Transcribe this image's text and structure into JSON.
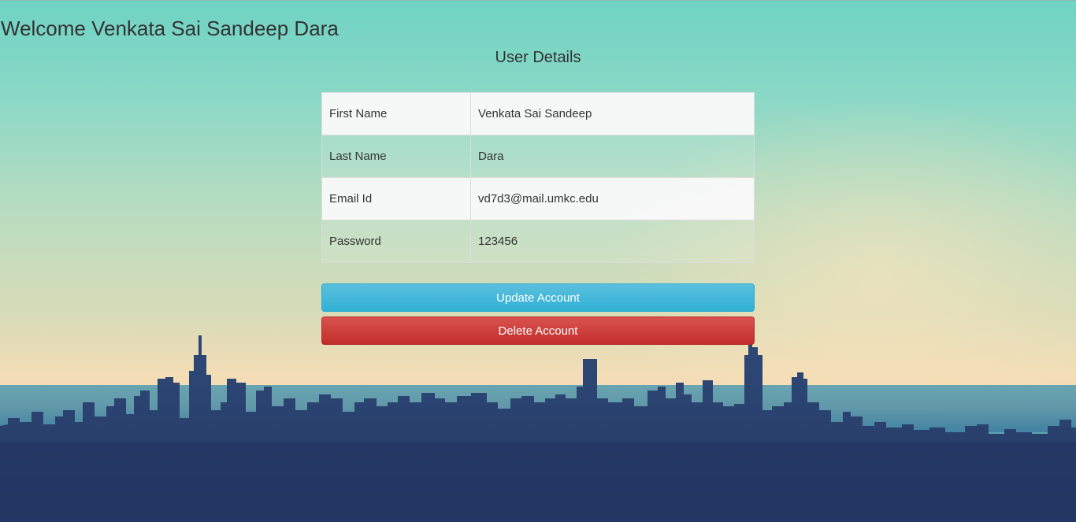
{
  "welcome_text": "Welcome Venkata Sai Sandeep Dara",
  "section_title": "User Details",
  "details": [
    {
      "label": "First Name",
      "value": "Venkata Sai Sandeep"
    },
    {
      "label": "Last Name",
      "value": "Dara"
    },
    {
      "label": "Email Id",
      "value": "vd7d3@mail.umkc.edu"
    },
    {
      "label": "Password",
      "value": "123456"
    }
  ],
  "buttons": {
    "update_label": "Update Account",
    "delete_label": "Delete Account"
  },
  "colors": {
    "update_button": "#5bc0de",
    "delete_button": "#d9534f",
    "text": "#333333"
  },
  "background": "city-skyline-image"
}
